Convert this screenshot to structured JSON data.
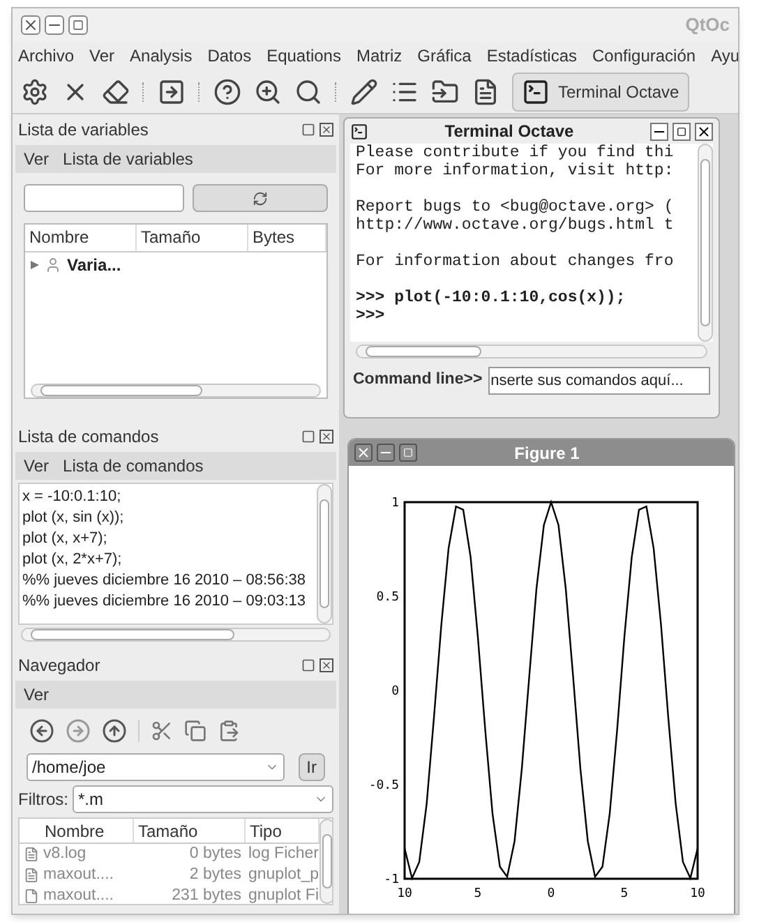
{
  "window": {
    "title": "QtOc"
  },
  "menu": [
    "Archivo",
    "Ver",
    "Analysis",
    "Datos",
    "Equations",
    "Matriz",
    "Gráfica",
    "Estadísticas",
    "Configuración",
    "Ayu"
  ],
  "toolbar": {
    "terminal_button": "Terminal Octave"
  },
  "variables_panel": {
    "title": "Lista de variables",
    "menu": [
      "Ver",
      "Lista de variables"
    ],
    "columns": [
      "Nombre",
      "Tamaño",
      "Bytes"
    ],
    "rows": [
      {
        "name": "Varia...",
        "expanded": false
      }
    ]
  },
  "commands_panel": {
    "title": "Lista de comandos",
    "menu": [
      "Ver",
      "Lista de comandos"
    ],
    "lines": [
      "x = -10:0.1:10;",
      "plot (x, sin (x));",
      "plot (x, x+7);",
      "plot (x, 2*x+7);",
      "%% jueves diciembre 16 2010 – 08:56:38",
      "%% jueves diciembre 16 2010 – 09:03:13"
    ]
  },
  "browser_panel": {
    "title": "Navegador",
    "menu": [
      "Ver"
    ],
    "path": "/home/joe",
    "go_button": "Ir",
    "filter_label": "Filtros:",
    "filter": "*.m",
    "columns": [
      "Nombre",
      "Tamaño",
      "Tipo"
    ],
    "rows": [
      {
        "name": "v8.log",
        "size": "0 bytes",
        "type": "log Ficher"
      },
      {
        "name": "maxout....",
        "size": "2 bytes",
        "type": "gnuplot_p"
      },
      {
        "name": "maxout....",
        "size": "231 bytes",
        "type": "gnuplot Fi"
      }
    ]
  },
  "terminal": {
    "title": "Terminal Octave",
    "blocks": [
      {
        "kind": "output",
        "lines": [
          "Please contribute if you find thi",
          "For more information, visit http:"
        ]
      },
      {
        "kind": "output",
        "lines": [
          "Report bugs to <bug@octave.org> (",
          "http://www.octave.org/bugs.html t"
        ]
      },
      {
        "kind": "output",
        "lines": [
          "For information about changes fro"
        ]
      },
      {
        "kind": "prompt",
        "lines": [
          ">>> plot(-10:0.1:10,cos(x));",
          ">>>"
        ]
      }
    ],
    "command_label": "Command line>>",
    "command_value": "nserte sus comandos aquí..."
  },
  "figure": {
    "title": "Figure 1",
    "chart_data": {
      "type": "line",
      "x": [
        -10,
        -9.5,
        -9,
        -8.5,
        -8,
        -7.5,
        -7,
        -6.5,
        -6,
        -5.5,
        -5,
        -4.5,
        -4,
        -3.5,
        -3,
        -2.5,
        -2,
        -1.5,
        -1,
        -0.5,
        0,
        0.5,
        1,
        1.5,
        2,
        2.5,
        3,
        3.5,
        4,
        4.5,
        5,
        5.5,
        6,
        6.5,
        7,
        7.5,
        8,
        8.5,
        9,
        9.5,
        10
      ],
      "series": [
        {
          "color": "#000000",
          "values": [
            -0.839,
            -0.997,
            -0.911,
            -0.602,
            -0.146,
            0.347,
            0.754,
            0.977,
            0.96,
            0.709,
            0.284,
            -0.211,
            -0.654,
            -0.936,
            -0.99,
            -0.801,
            -0.416,
            0.071,
            0.54,
            0.878,
            1,
            0.878,
            0.54,
            0.071,
            -0.416,
            -0.801,
            -0.99,
            -0.936,
            -0.654,
            -0.211,
            0.284,
            0.709,
            0.96,
            0.977,
            0.754,
            0.347,
            -0.146,
            -0.602,
            -0.911,
            -0.997,
            -0.839
          ]
        }
      ],
      "xlim": [
        -10,
        10
      ],
      "ylim": [
        -1,
        1
      ],
      "xticks": [
        {
          "value": -10,
          "label": "10"
        },
        {
          "value": -5,
          "label": "5"
        },
        {
          "value": 0,
          "label": "0"
        },
        {
          "value": 5,
          "label": "5"
        },
        {
          "value": 10,
          "label": "10"
        }
      ],
      "yticks": [
        {
          "value": -1,
          "label": "-1"
        },
        {
          "value": -0.5,
          "label": "-0.5"
        },
        {
          "value": 0,
          "label": "0"
        },
        {
          "value": 0.5,
          "label": "0.5"
        },
        {
          "value": 1,
          "label": "1"
        }
      ]
    }
  }
}
